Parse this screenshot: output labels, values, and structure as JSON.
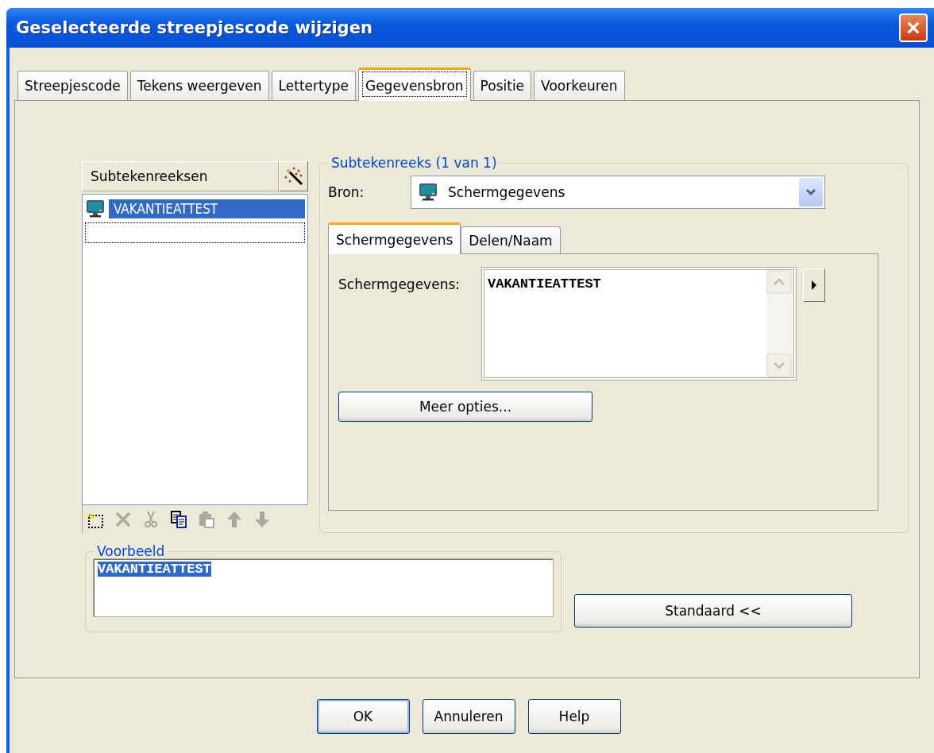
{
  "window": {
    "title": "Geselecteerde streepjescode wijzigen"
  },
  "tabs": [
    {
      "label": "Streepjescode",
      "selected": false
    },
    {
      "label": "Tekens weergeven",
      "selected": false
    },
    {
      "label": "Lettertype",
      "selected": false
    },
    {
      "label": "Gegevensbron",
      "selected": true
    },
    {
      "label": "Positie",
      "selected": false
    },
    {
      "label": "Voorkeuren",
      "selected": false
    }
  ],
  "substrings": {
    "header": "Subtekenreeksen",
    "items": [
      {
        "label": "VAKANTIEATTEST",
        "selected": true
      }
    ],
    "toolbar": [
      {
        "kind": "new",
        "disabled": false
      },
      {
        "kind": "delete",
        "disabled": true
      },
      {
        "kind": "cut",
        "disabled": true
      },
      {
        "kind": "copy",
        "disabled": false
      },
      {
        "kind": "paste",
        "disabled": true
      },
      {
        "kind": "up",
        "disabled": true
      },
      {
        "kind": "down",
        "disabled": true
      }
    ]
  },
  "substring_group": {
    "legend": "Subtekenreeks (1 van 1)",
    "source_label": "Bron:",
    "source_value": "Schermgegevens",
    "tabs": [
      {
        "label": "Schermgegevens",
        "selected": true
      },
      {
        "label": "Delen/Naam",
        "selected": false
      }
    ],
    "data_label": "Schermgegevens:",
    "data_value": "VAKANTIEATTEST",
    "more_button": "Meer opties..."
  },
  "preview": {
    "legend": "Voorbeeld",
    "value": "VAKANTIEATTEST",
    "selected": true
  },
  "standard_button": "Standaard <<",
  "buttons": [
    {
      "label": "OK",
      "default": true
    },
    {
      "label": "Annuleren",
      "default": false
    },
    {
      "label": "Help",
      "default": false
    }
  ]
}
